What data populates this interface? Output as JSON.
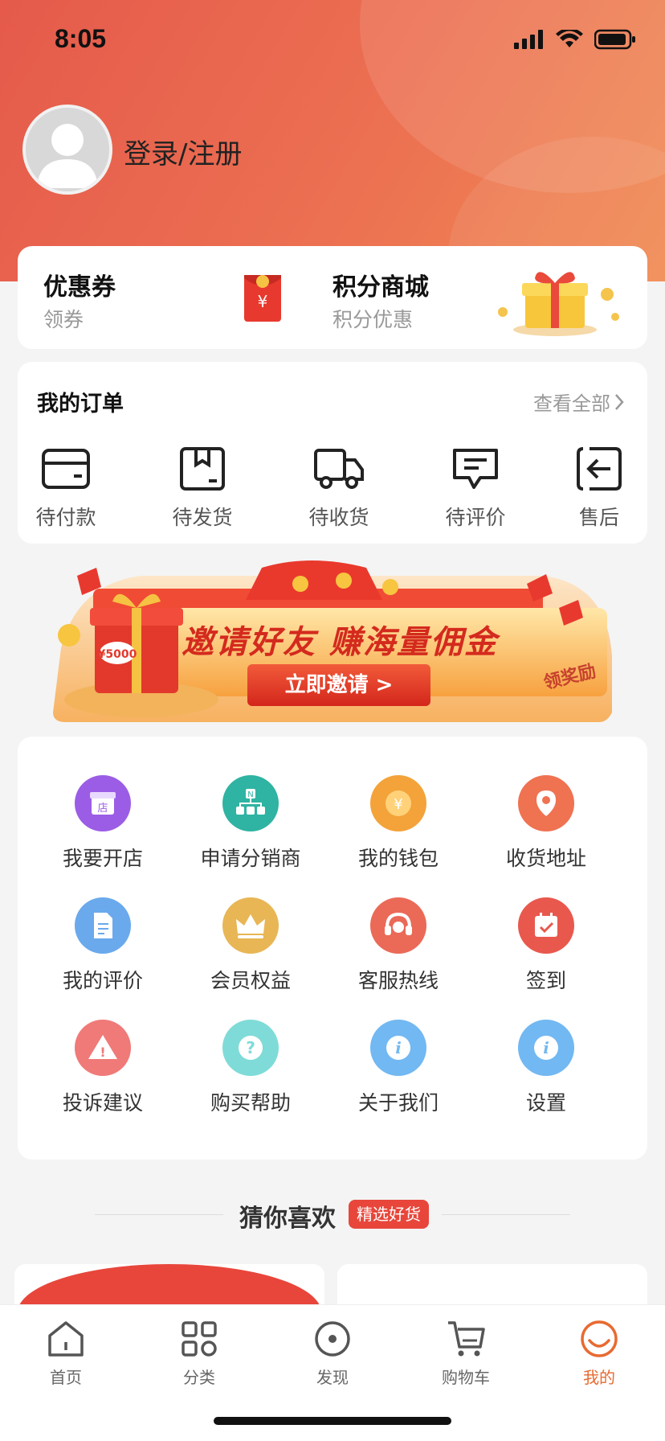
{
  "status_bar": {
    "time": "8:05"
  },
  "profile": {
    "login_label": "登录/注册"
  },
  "promo": {
    "coupon": {
      "title": "优惠券",
      "subtitle": "领券"
    },
    "points": {
      "title": "积分商城",
      "subtitle": "积分优惠"
    },
    "coupon_symbol": "¥"
  },
  "orders": {
    "title": "我的订单",
    "view_all": "查看全部",
    "items": [
      {
        "label": "待付款",
        "icon": "wallet-icon"
      },
      {
        "label": "待发货",
        "icon": "box-icon"
      },
      {
        "label": "待收货",
        "icon": "truck-icon"
      },
      {
        "label": "待评价",
        "icon": "comment-icon"
      },
      {
        "label": "售后",
        "icon": "return-icon"
      }
    ]
  },
  "banner": {
    "headline": "邀请好友 赚海量佣金",
    "button": "立即邀请 >",
    "tag": "领奖励",
    "gift_amount": "¥5000"
  },
  "services": [
    {
      "label": "我要开店",
      "icon": "shop-icon",
      "color": "#9b5de5",
      "glyph": "店"
    },
    {
      "label": "申请分销商",
      "icon": "distributor-icon",
      "color": "#2fb3a2",
      "glyph": "N"
    },
    {
      "label": "我的钱包",
      "icon": "wallet-coin-icon",
      "color": "#f3a33a",
      "glyph": "¥"
    },
    {
      "label": "收货地址",
      "icon": "location-icon",
      "color": "#ef7251",
      "glyph": ""
    },
    {
      "label": "我的评价",
      "icon": "document-icon",
      "color": "#6aa9ec",
      "glyph": ""
    },
    {
      "label": "会员权益",
      "icon": "crown-icon",
      "color": "#e8b655",
      "glyph": ""
    },
    {
      "label": "客服热线",
      "icon": "headset-icon",
      "color": "#ea6a57",
      "glyph": ""
    },
    {
      "label": "签到",
      "icon": "calendar-check-icon",
      "color": "#e9584d",
      "glyph": ""
    },
    {
      "label": "投诉建议",
      "icon": "warning-icon",
      "color": "#ef7a78",
      "glyph": "!"
    },
    {
      "label": "购买帮助",
      "icon": "help-icon",
      "color": "#7fdbd8",
      "glyph": "?"
    },
    {
      "label": "关于我们",
      "icon": "info-icon",
      "color": "#72b8f2",
      "glyph": "i"
    },
    {
      "label": "设置",
      "icon": "info-icon",
      "color": "#72b8f2",
      "glyph": "i"
    }
  ],
  "guess": {
    "title": "猜你喜欢",
    "badge": "精选好货"
  },
  "tabbar": [
    {
      "label": "首页",
      "icon": "home-icon",
      "active": false
    },
    {
      "label": "分类",
      "icon": "category-icon",
      "active": false
    },
    {
      "label": "发现",
      "icon": "discover-icon",
      "active": false
    },
    {
      "label": "购物车",
      "icon": "cart-icon",
      "active": false
    },
    {
      "label": "我的",
      "icon": "profile-smile-icon",
      "active": true
    }
  ],
  "colors": {
    "accent": "#e86a31",
    "header_start": "#e55a4b",
    "header_end": "#f08a52",
    "badge": "#e8463b"
  }
}
